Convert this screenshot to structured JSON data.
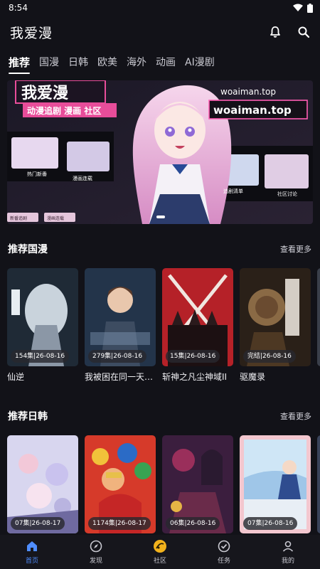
{
  "status_bar": {
    "time": "8:54"
  },
  "header": {
    "title": "我爱漫"
  },
  "tabs": [
    {
      "label": "推荐",
      "active": true
    },
    {
      "label": "国漫"
    },
    {
      "label": "日韩"
    },
    {
      "label": "欧美"
    },
    {
      "label": "海外"
    },
    {
      "label": "动画"
    },
    {
      "label": "AI漫剧"
    }
  ],
  "banner": {
    "logo_text": "我爱漫",
    "subtitle": "动漫追剧 漫画 社区",
    "site_small": "woaiman.top",
    "site_large": "woaiman.top",
    "tiles": [
      "热门新番",
      "漫画连载",
      "追剧清单",
      "社区讨论"
    ],
    "chips": [
      "新番追剧",
      "漫画连载"
    ]
  },
  "sections": [
    {
      "title": "推荐国漫",
      "more": "查看更多",
      "items": [
        {
          "badge": "154集|26-08-16",
          "title": "仙逆"
        },
        {
          "badge": "279集|26-08-16",
          "title": "我被困在同一天十万年"
        },
        {
          "badge": "15集|26-08-16",
          "title": "斩神之凡尘神域II"
        },
        {
          "badge": "完结|26-08-16",
          "title": "驱魔录"
        }
      ]
    },
    {
      "title": "推荐日韩",
      "more": "查看更多",
      "items": [
        {
          "badge": "07集|26-08-17",
          "title": ""
        },
        {
          "badge": "1174集|26-08-17",
          "title": ""
        },
        {
          "badge": "06集|26-08-16",
          "title": ""
        },
        {
          "badge": "07集|26-08-16",
          "title": ""
        }
      ]
    }
  ],
  "bottom_nav": [
    {
      "label": "首页",
      "icon": "home-icon",
      "active": true
    },
    {
      "label": "发现",
      "icon": "compass-icon"
    },
    {
      "label": "社区",
      "icon": "community-icon"
    },
    {
      "label": "任务",
      "icon": "task-check-icon"
    },
    {
      "label": "我的",
      "icon": "profile-icon"
    }
  ],
  "colors": {
    "background": "#121218",
    "accent": "#4f8dff",
    "banner_pink": "#e84d9a"
  }
}
